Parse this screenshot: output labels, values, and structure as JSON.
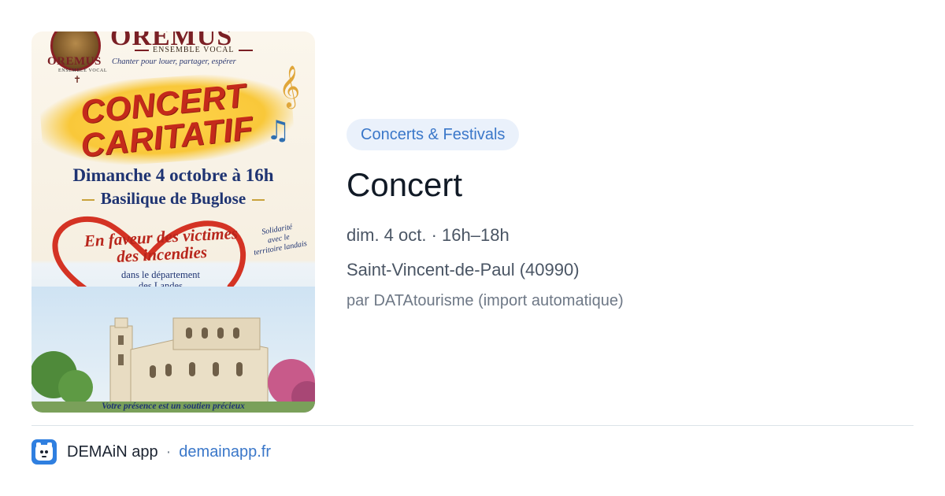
{
  "poster": {
    "logo_name": "OREMUS",
    "logo_small": "ENSEMBLE VOCAL",
    "brand": "OREMUS",
    "brand_sub": "ENSEMBLE VOCAL",
    "tagline": "Chanter pour louer, partager, espérer",
    "title_line1": "CONCERT",
    "title_line2": "CARITATIF",
    "date": "Dimanche 4 octobre à 16h",
    "venue": "Basilique de Buglose",
    "cause_line1": "En faveur des victimes",
    "cause_line2": "des incendies",
    "cause_sub_line1": "dans le département",
    "cause_sub_line2": "des Landes",
    "solidarity_line1": "Solidarité",
    "solidarity_line2": "avec le",
    "solidarity_line3": "territoire landais",
    "footer": "Votre présence est un soutien précieux",
    "colors": {
      "red": "#c42a1b",
      "navy": "#1f3472",
      "gold": "#f9c83a"
    }
  },
  "event": {
    "category": "Concerts & Festivals",
    "title": "Concert",
    "datetime": "dim. 4 oct. · 16h–18h",
    "location": "Saint-Vincent-de-Paul (40990)",
    "source": "par DATAtourisme (import automatique)"
  },
  "footer": {
    "app_icon": "app-logo-icon",
    "app_name": "DEMAiN app",
    "separator": "·",
    "link": "demainapp.fr",
    "accent": "#3a77c9"
  }
}
